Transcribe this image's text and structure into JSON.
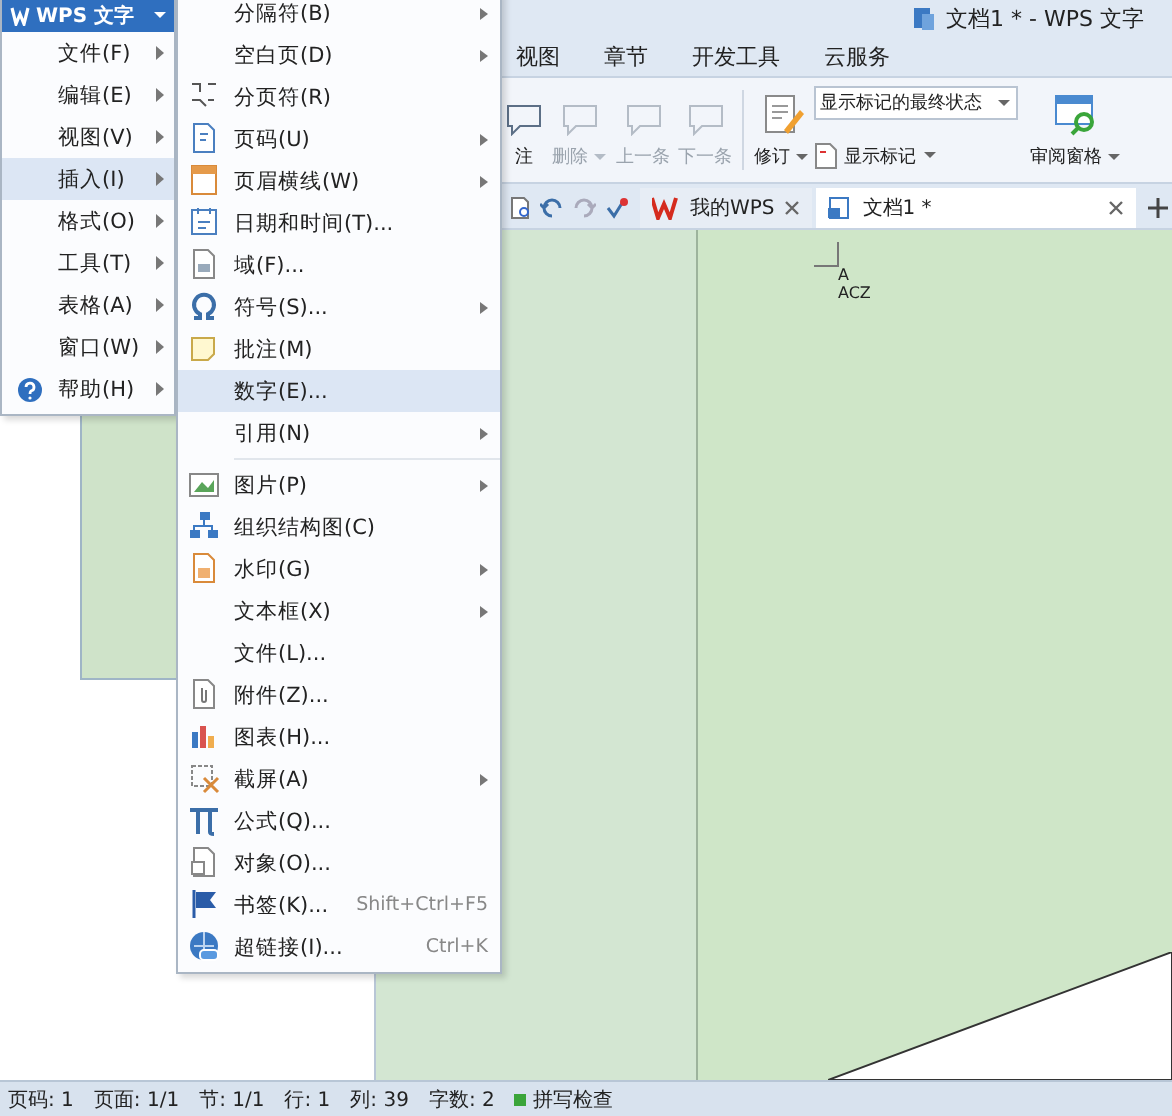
{
  "window": {
    "title": "文档1 * - WPS 文字"
  },
  "ribbon_tabs": [
    {
      "label": "视图"
    },
    {
      "label": "章节"
    },
    {
      "label": "开发工具"
    },
    {
      "label": "云服务"
    }
  ],
  "ribbon": {
    "comment_buttons": [
      {
        "label": "注",
        "disabled": false,
        "dropdown": false
      },
      {
        "label": "删除",
        "disabled": true,
        "dropdown": true
      },
      {
        "label": "上一条",
        "disabled": true,
        "dropdown": false
      },
      {
        "label": "下一条",
        "disabled": true,
        "dropdown": false
      }
    ],
    "track_changes": {
      "label": "修订"
    },
    "markup_mode": {
      "value": "显示标记的最终状态"
    },
    "show_markup": {
      "label": "显示标记"
    },
    "review_pane": {
      "label": "审阅窗格"
    }
  },
  "doc_tabs": [
    {
      "label": "我的WPS",
      "selected": false
    },
    {
      "label": "文档1 *",
      "selected": true
    }
  ],
  "document": {
    "lines": [
      "A",
      "ACZ"
    ]
  },
  "status_bar": {
    "items": [
      "页码: 1",
      "页面: 1/1",
      "节: 1/1",
      "行: 1",
      "列: 39",
      "字数: 2"
    ],
    "spell_check": "拼写检查"
  },
  "app_menu": {
    "title": "WPS 文字",
    "items": [
      {
        "label": "文件(F)",
        "selected": false
      },
      {
        "label": "编辑(E)",
        "selected": false
      },
      {
        "label": "视图(V)",
        "selected": false
      },
      {
        "label": "插入(I)",
        "selected": true
      },
      {
        "label": "格式(O)",
        "selected": false
      },
      {
        "label": "工具(T)",
        "selected": false
      },
      {
        "label": "表格(A)",
        "selected": false
      },
      {
        "label": "窗口(W)",
        "selected": false
      },
      {
        "label": "帮助(H)",
        "selected": false
      }
    ]
  },
  "insert_menu": {
    "items": [
      {
        "label": "分隔符(B)",
        "selected": false,
        "submenu": true
      },
      {
        "label": "空白页(D)",
        "selected": false,
        "submenu": true
      },
      {
        "label": "分页符(R)",
        "selected": false,
        "submenu": false
      },
      {
        "label": "页码(U)",
        "selected": false,
        "submenu": true
      },
      {
        "label": "页眉横线(W)",
        "selected": false,
        "submenu": true
      },
      {
        "label": "日期和时间(T)...",
        "selected": false,
        "submenu": false
      },
      {
        "label": "域(F)...",
        "selected": false,
        "submenu": false
      },
      {
        "label": "符号(S)...",
        "selected": false,
        "submenu": true
      },
      {
        "label": "批注(M)",
        "selected": false,
        "submenu": false
      },
      {
        "label": "数字(E)...",
        "selected": true,
        "submenu": false
      },
      {
        "label": "引用(N)",
        "selected": false,
        "submenu": true,
        "separator_after": true
      },
      {
        "label": "图片(P)",
        "selected": false,
        "submenu": true
      },
      {
        "label": "组织结构图(C)",
        "selected": false,
        "submenu": false
      },
      {
        "label": "水印(G)",
        "selected": false,
        "submenu": true
      },
      {
        "label": "文本框(X)",
        "selected": false,
        "submenu": true
      },
      {
        "label": "文件(L)...",
        "selected": false,
        "submenu": false
      },
      {
        "label": "附件(Z)...",
        "selected": false,
        "submenu": false
      },
      {
        "label": "图表(H)...",
        "selected": false,
        "submenu": false
      },
      {
        "label": "截屏(A)",
        "selected": false,
        "submenu": true
      },
      {
        "label": "公式(Q)...",
        "selected": false,
        "submenu": false
      },
      {
        "label": "对象(O)...",
        "selected": false,
        "submenu": false
      },
      {
        "label": "书签(K)...",
        "selected": false,
        "submenu": false,
        "shortcut": "Shift+Ctrl+F5"
      },
      {
        "label": "超链接(I)...",
        "selected": false,
        "submenu": false,
        "shortcut": "Ctrl+K"
      }
    ]
  }
}
